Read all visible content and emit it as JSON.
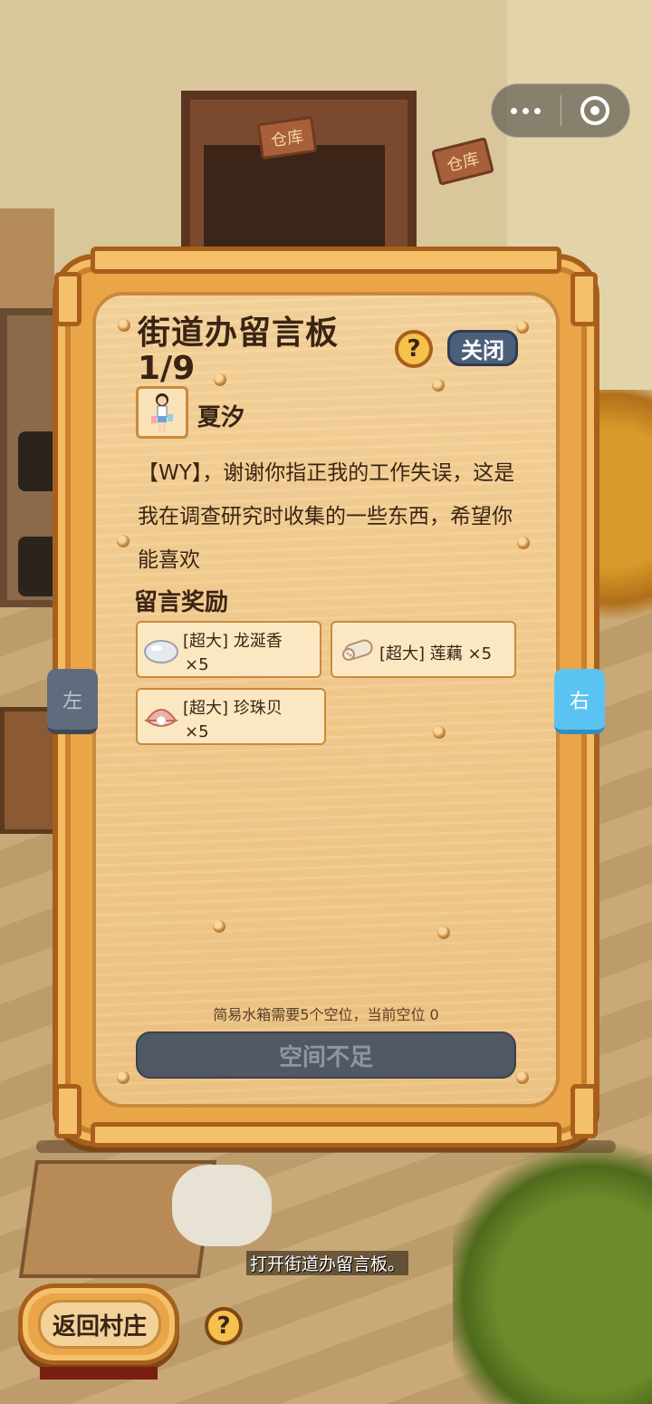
{
  "board": {
    "title": "街道办留言板",
    "page": "1/9",
    "help_label": "?",
    "close_label": "关闭",
    "sender": {
      "name": "夏汐"
    },
    "message": "【WY】，谢谢你指正我的工作失误，这是我在调查研究时收集的一些东西，希望你能喜欢",
    "rewards_title": "留言奖励",
    "rewards": [
      {
        "name": "[超大] 龙涎香",
        "qty": "×5",
        "icon": "ambergris-icon"
      },
      {
        "name": "[超大] 莲藕",
        "qty": "×5",
        "icon": "lotus-root-icon"
      },
      {
        "name": "[超大] 珍珠贝",
        "qty": "×5",
        "icon": "pearl-shell-icon"
      }
    ],
    "storage_note": "简易水箱需要5个空位，当前空位 0",
    "action_label": "空间不足"
  },
  "nav": {
    "prev_label": "左",
    "next_label": "右"
  },
  "background": {
    "sign_1": "仓库",
    "sign_2": "仓库"
  },
  "hint": "打开街道办留言板。",
  "bottom": {
    "return_label": "返回村庄",
    "help_label": "?"
  },
  "colors": {
    "board_wood": "#f3cb8d",
    "frame": "#e9a548",
    "close_button": "#4c5f7a",
    "next_button": "#5bc3f2",
    "disabled_button": "#4f5864"
  }
}
